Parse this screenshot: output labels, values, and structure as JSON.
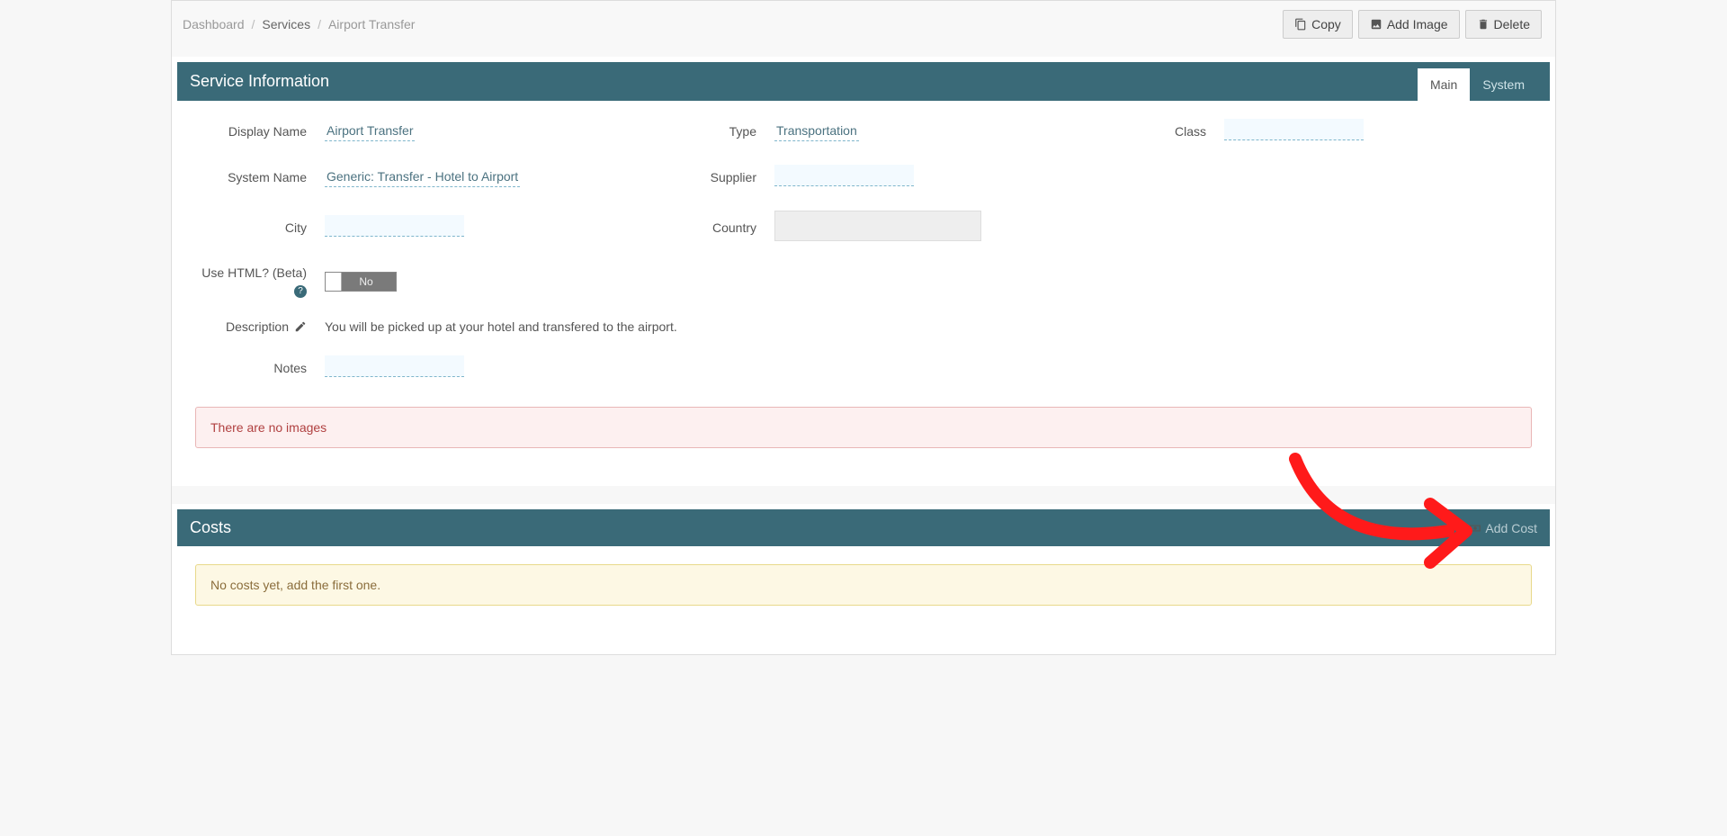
{
  "breadcrumb": {
    "dashboard": "Dashboard",
    "services": "Services",
    "current": "Airport Transfer"
  },
  "toolbar": {
    "copy": "Copy",
    "add_image": "Add Image",
    "delete": "Delete"
  },
  "service_info": {
    "title": "Service Information",
    "tabs": {
      "main": "Main",
      "system": "System"
    },
    "labels": {
      "display_name": "Display Name",
      "system_name": "System Name",
      "city": "City",
      "type": "Type",
      "supplier": "Supplier",
      "country": "Country",
      "class": "Class",
      "use_html": "Use HTML? (Beta)",
      "description": "Description",
      "notes": "Notes"
    },
    "values": {
      "display_name": "Airport Transfer",
      "system_name": "Generic: Transfer - Hotel to Airport",
      "type": "Transportation",
      "description": "You will be picked up at your hotel and transfered to the airport.",
      "use_html_toggle": "No"
    },
    "alert_no_images": "There are no images"
  },
  "costs": {
    "title": "Costs",
    "add_cost": "Add Cost",
    "alert_no_costs": "No costs yet, add the first one."
  }
}
